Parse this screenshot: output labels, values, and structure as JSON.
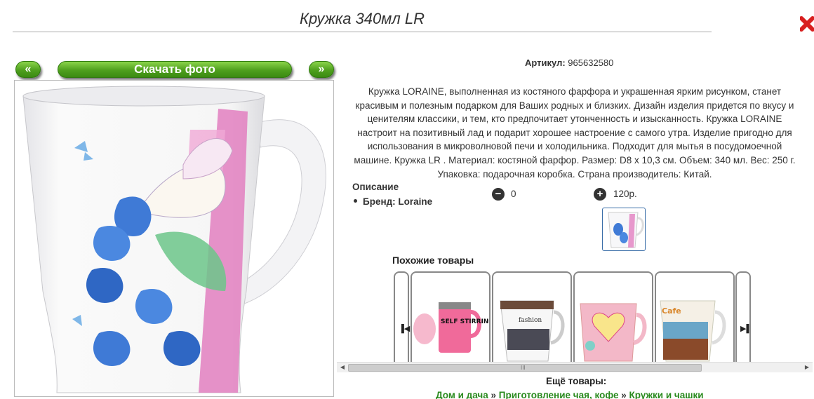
{
  "header": {
    "title": "Кружка 340мл LR"
  },
  "gallery": {
    "prev_label": "«",
    "next_label": "»",
    "download_label": "Скачать фото"
  },
  "product": {
    "sku_label": "Артикул:",
    "sku_value": "965632580",
    "description_lines": [
      "Кружка LORAINE, выполненная из костяного фарфора и украшенная ярким рисунком, станет",
      "красивым и полезным подарком для Ваших родных и близких. Дизайн изделия придется по вкусу и",
      "ценителям классики, и тем, кто предпочитает утонченность и изысканность. Кружка LORAINE",
      "настроит на позитивный лад и подарит хорошее настроение с самого утра. Изделие пригодно для",
      "использования в микроволновой печи и холодильника. Подходит для мытья в посудомоечной",
      "машине. Кружка LR . Материал: костяной фарфор. Размер: D8 х 10,3 см. Объем: 340 мл. Вес: 250 г.",
      "Упаковка: подарочная коробка. Страна производитель: Китай."
    ],
    "props_title": "Описание",
    "props": [
      "Бренд: Loraine"
    ],
    "qty_minus": "−",
    "qty_value": "0",
    "qty_plus": "+",
    "price": "120р."
  },
  "similar": {
    "title": "Похожие товары",
    "prev_icon": "▐◀",
    "next_icon": "▶▌",
    "card_texts": [
      "SELF STIRRING MUG",
      "fashion",
      "",
      "Cafe"
    ]
  },
  "scrollbar": {
    "grip": "III",
    "left": "◀",
    "right": "▶"
  },
  "footer": {
    "more_title": "Ещё товары:",
    "crumbs": [
      "Дом и дача",
      "Приготовление чая, кофе",
      "Кружки и чашки"
    ],
    "separator": " » "
  },
  "colors": {
    "accent_green": "#4fa01e",
    "link_green": "#2a8a1e",
    "close_red": "#d81f1f"
  },
  "icons": {
    "close": "close-icon",
    "minus": "minus-circle-icon",
    "plus": "plus-circle-icon"
  }
}
